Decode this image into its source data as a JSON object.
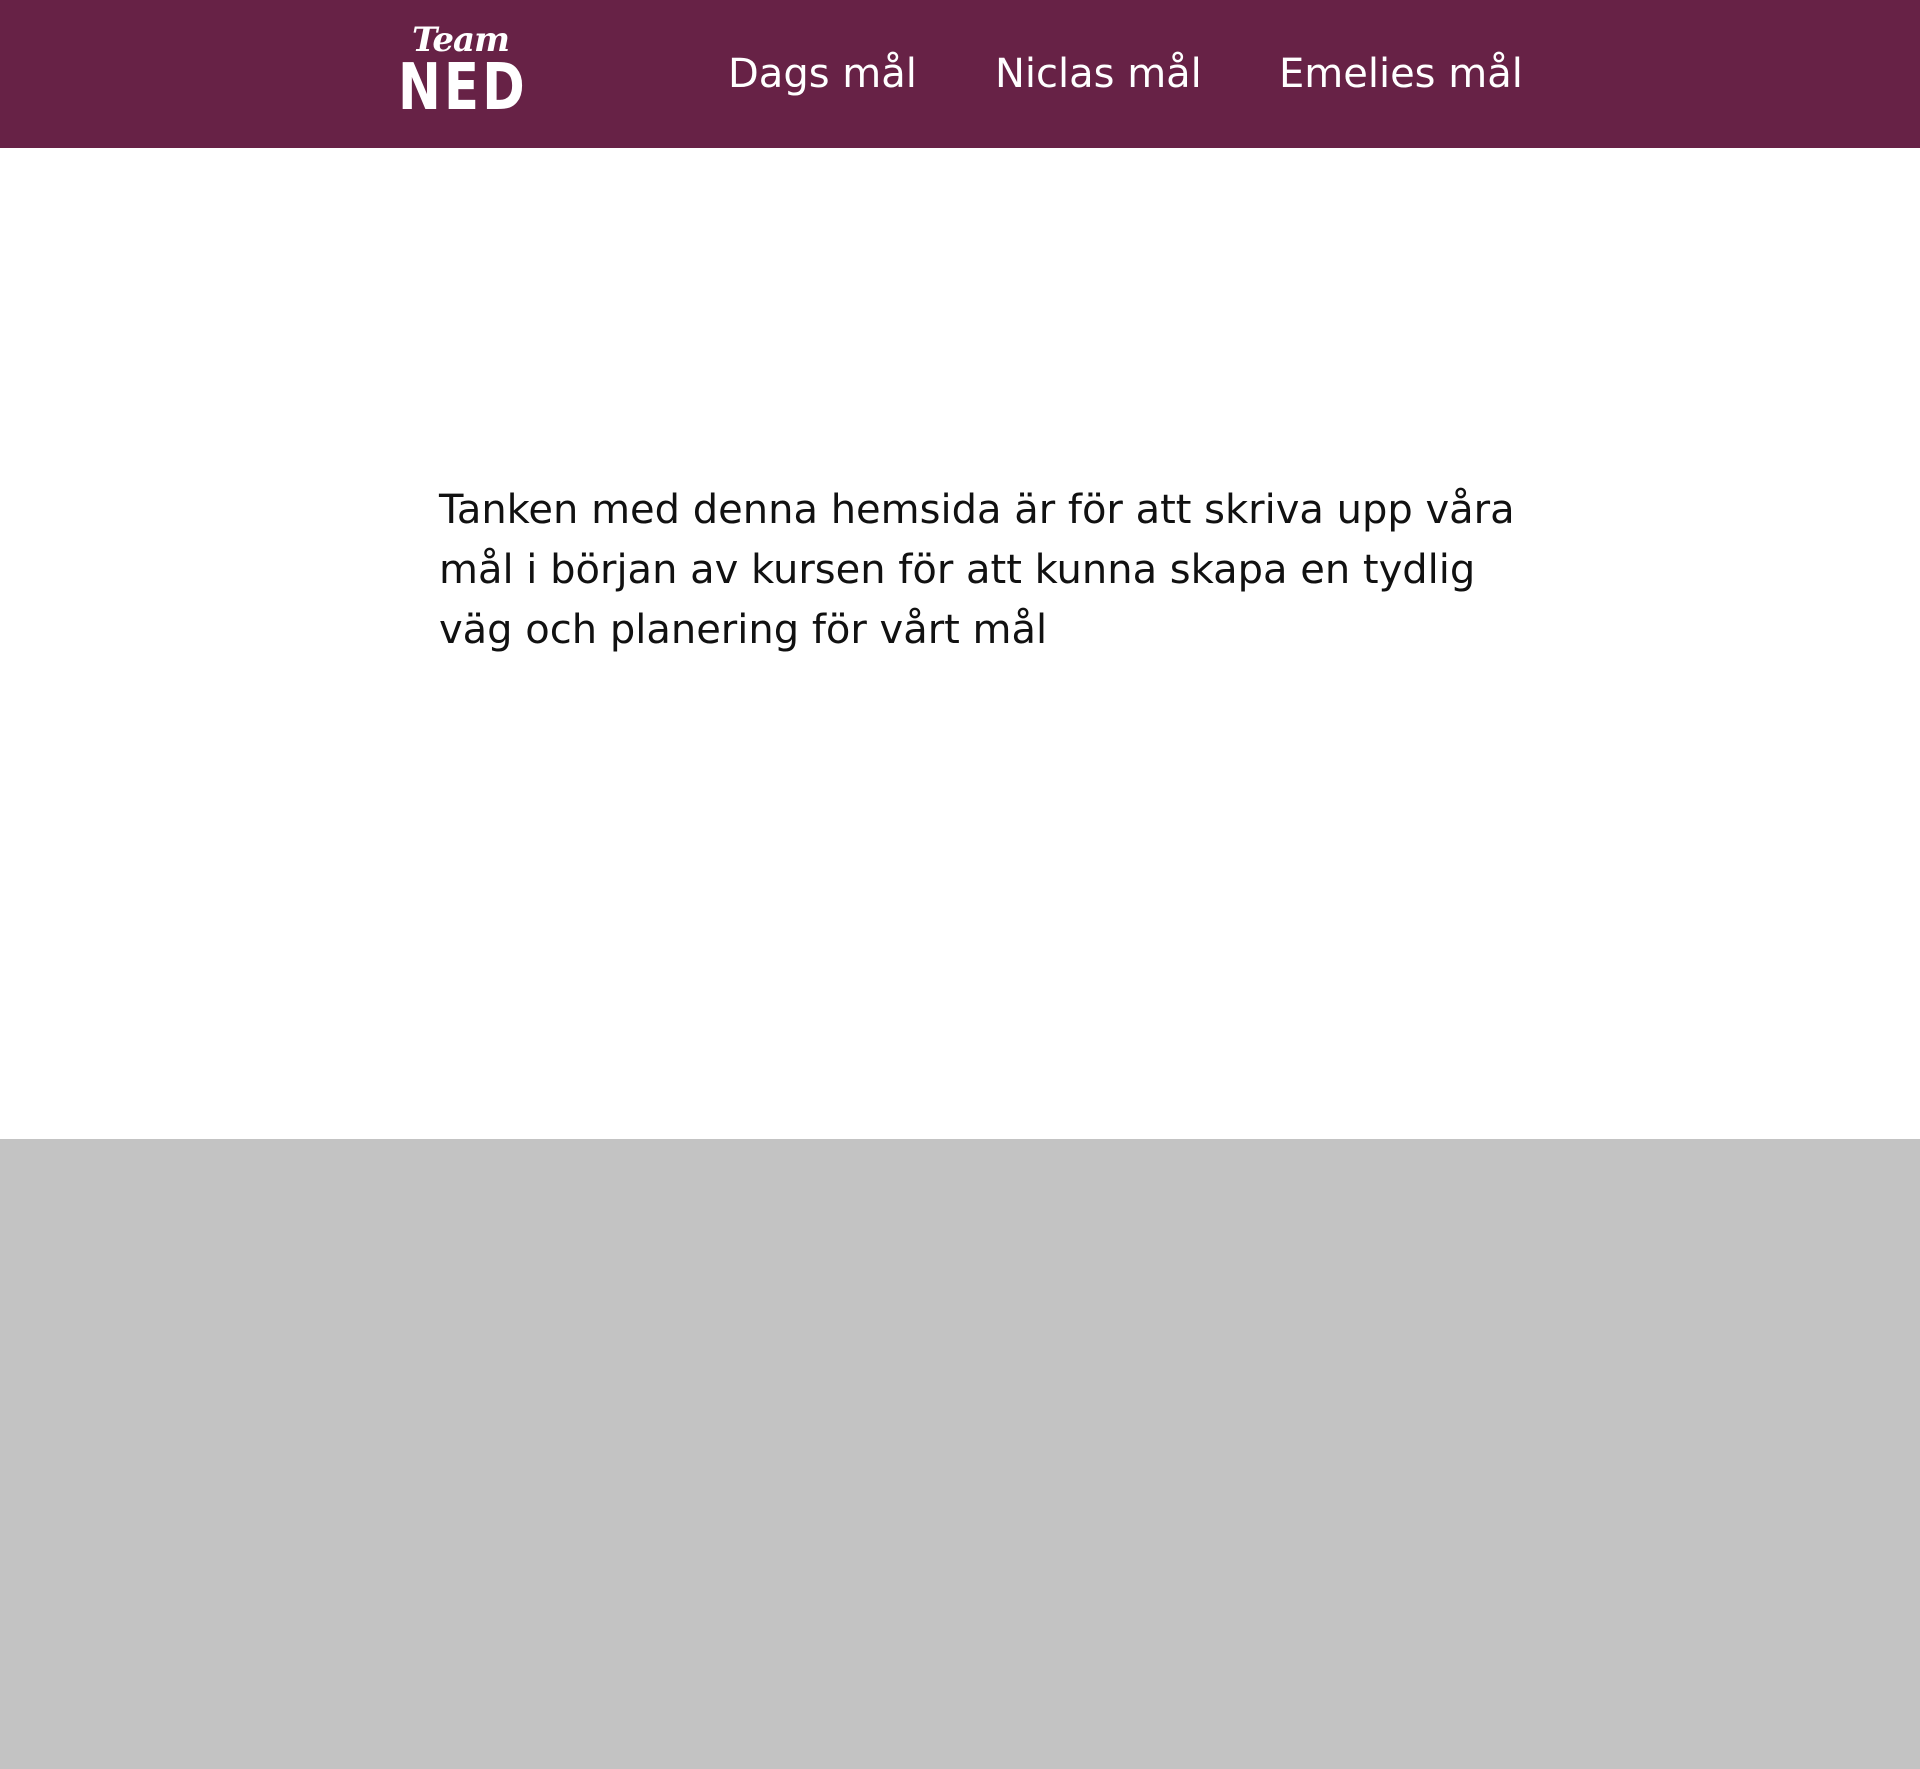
{
  "header": {
    "logo": {
      "line1": "Team",
      "line2": "NED"
    },
    "nav": [
      {
        "label": "Dags mål"
      },
      {
        "label": "Niclas mål"
      },
      {
        "label": "Emelies mål"
      }
    ]
  },
  "main": {
    "intro": "Tanken med denna hemsida är för att skriva upp våra mål i början av kursen för att kunna skapa en tydlig väg och planering för vårt mål"
  },
  "colors": {
    "header_background": "#672246",
    "footer_background": "#c3c3c3",
    "header_text": "#ffffff"
  }
}
